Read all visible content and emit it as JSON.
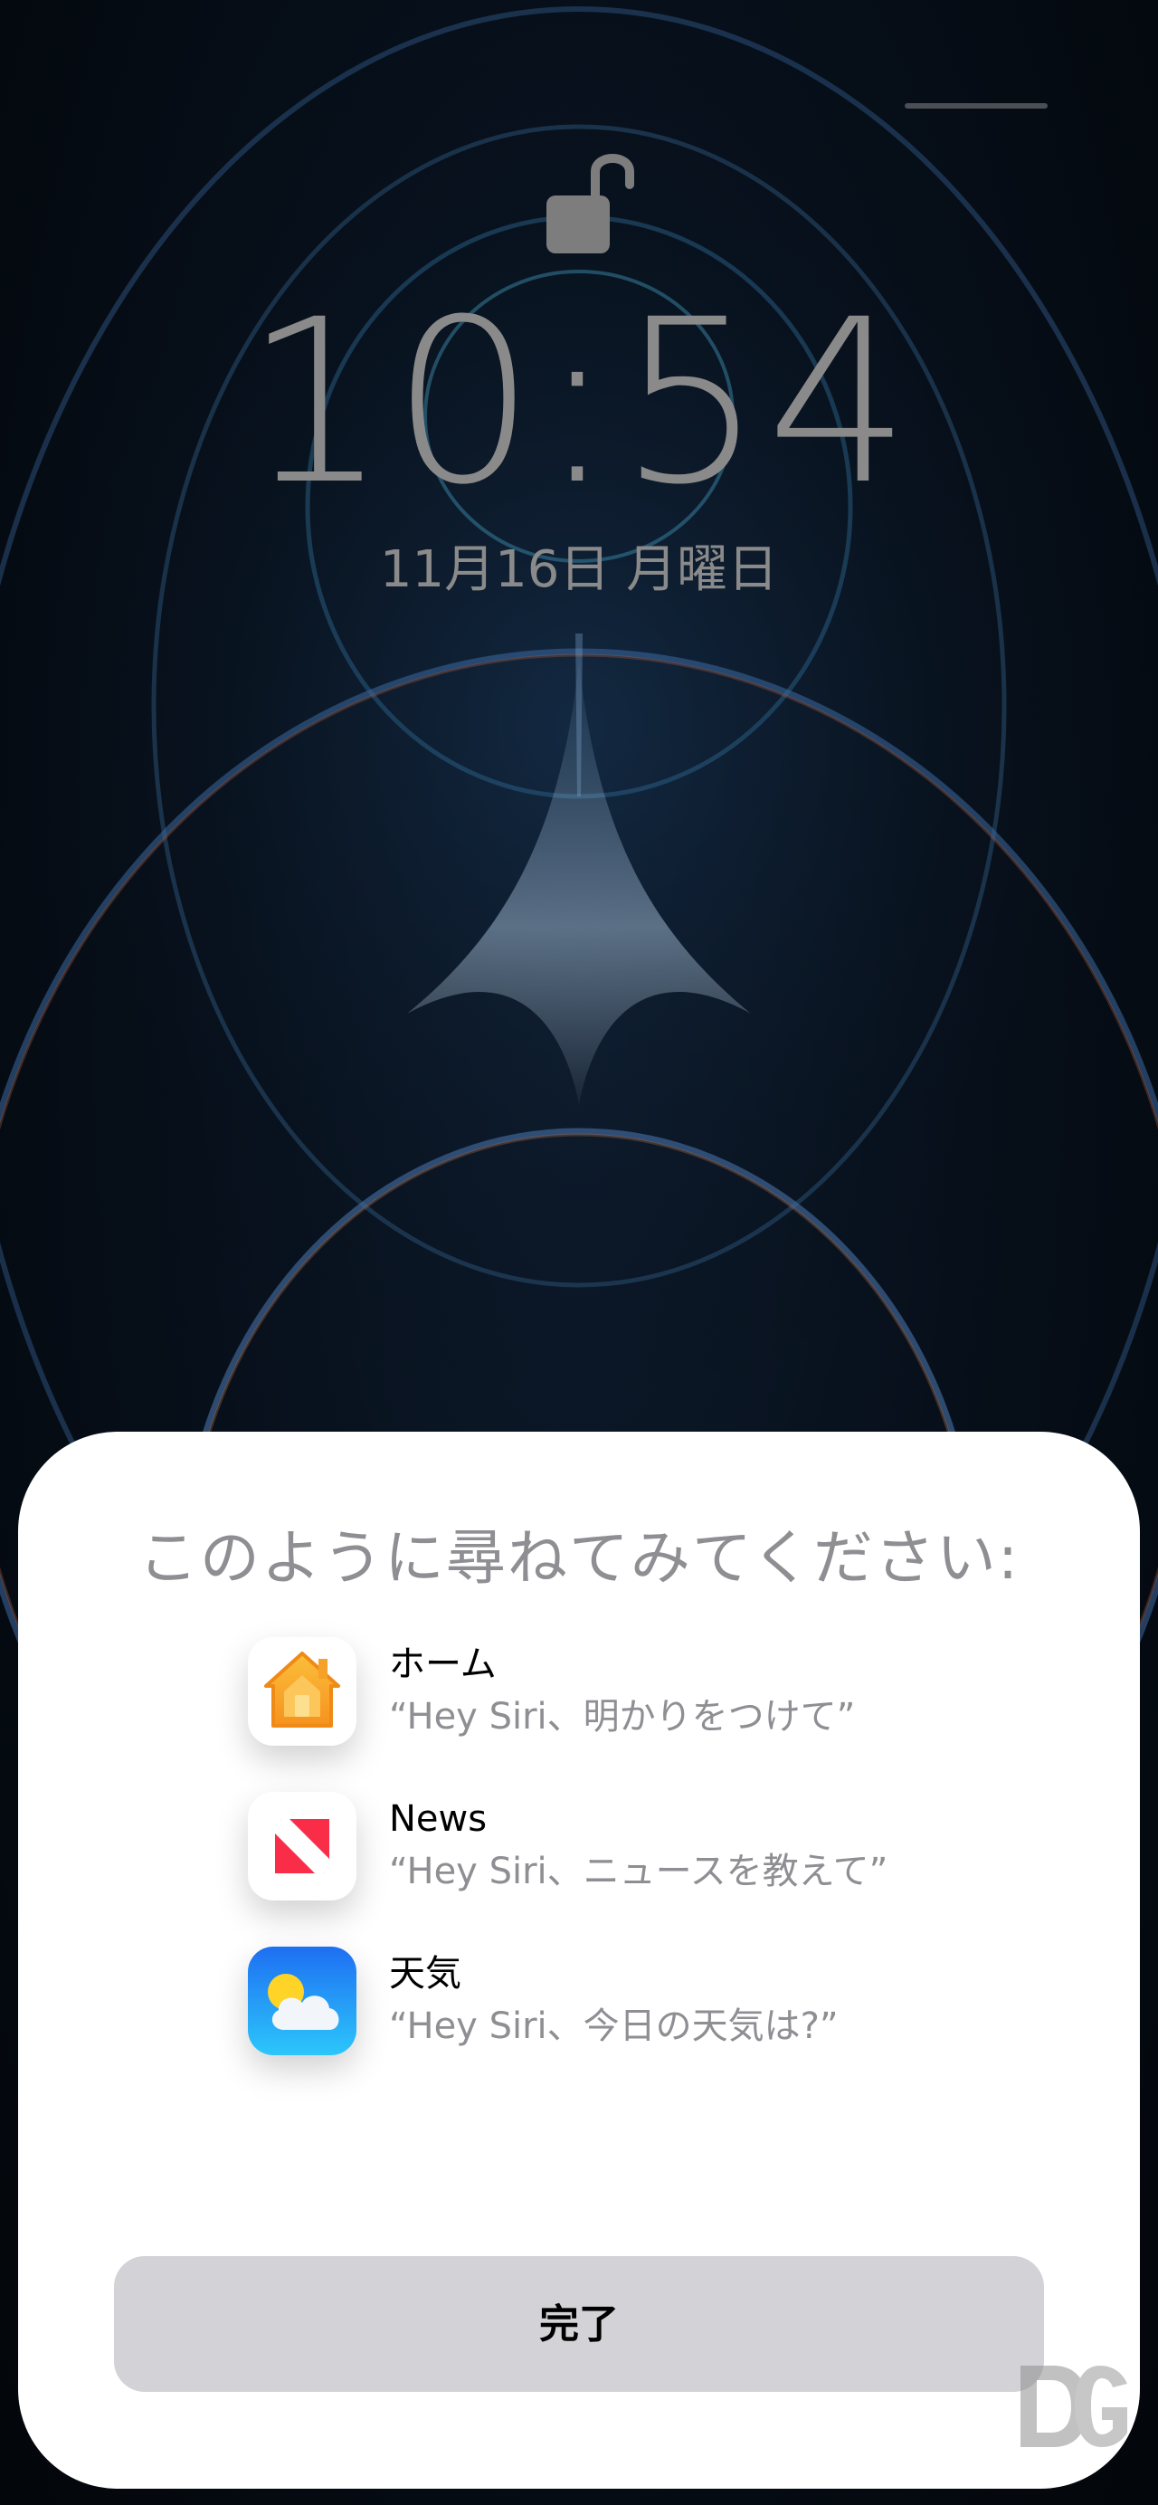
{
  "lock_screen": {
    "time": "10:54",
    "date": "11月16日 月曜日",
    "lock_icon": "lock-open-icon"
  },
  "siri_sheet": {
    "title": "このように尋ねてみてください:",
    "suggestions": [
      {
        "app": "ホーム",
        "phrase": "“Hey Siri、明かりをつけて”",
        "icon": "home-app-icon",
        "colors": [
          "#fbbf3b",
          "#f6921e"
        ]
      },
      {
        "app": "News",
        "phrase": "“Hey Siri、ニュースを教えて”",
        "icon": "news-app-icon",
        "colors": [
          "#ff4257",
          "#fa2d48"
        ]
      },
      {
        "app": "天気",
        "phrase": "“Hey Siri、今日の天気は?”",
        "icon": "weather-app-icon",
        "colors": [
          "#1e6ff2",
          "#2cc6fb"
        ]
      }
    ],
    "done_label": "完了"
  },
  "watermark": "dg-logo",
  "colors": {
    "sheet_background": "#ffffff",
    "button_background": "#d2d2d7",
    "secondary_text": "#8e8e93",
    "lock_screen_text": "#8a8a8a"
  }
}
